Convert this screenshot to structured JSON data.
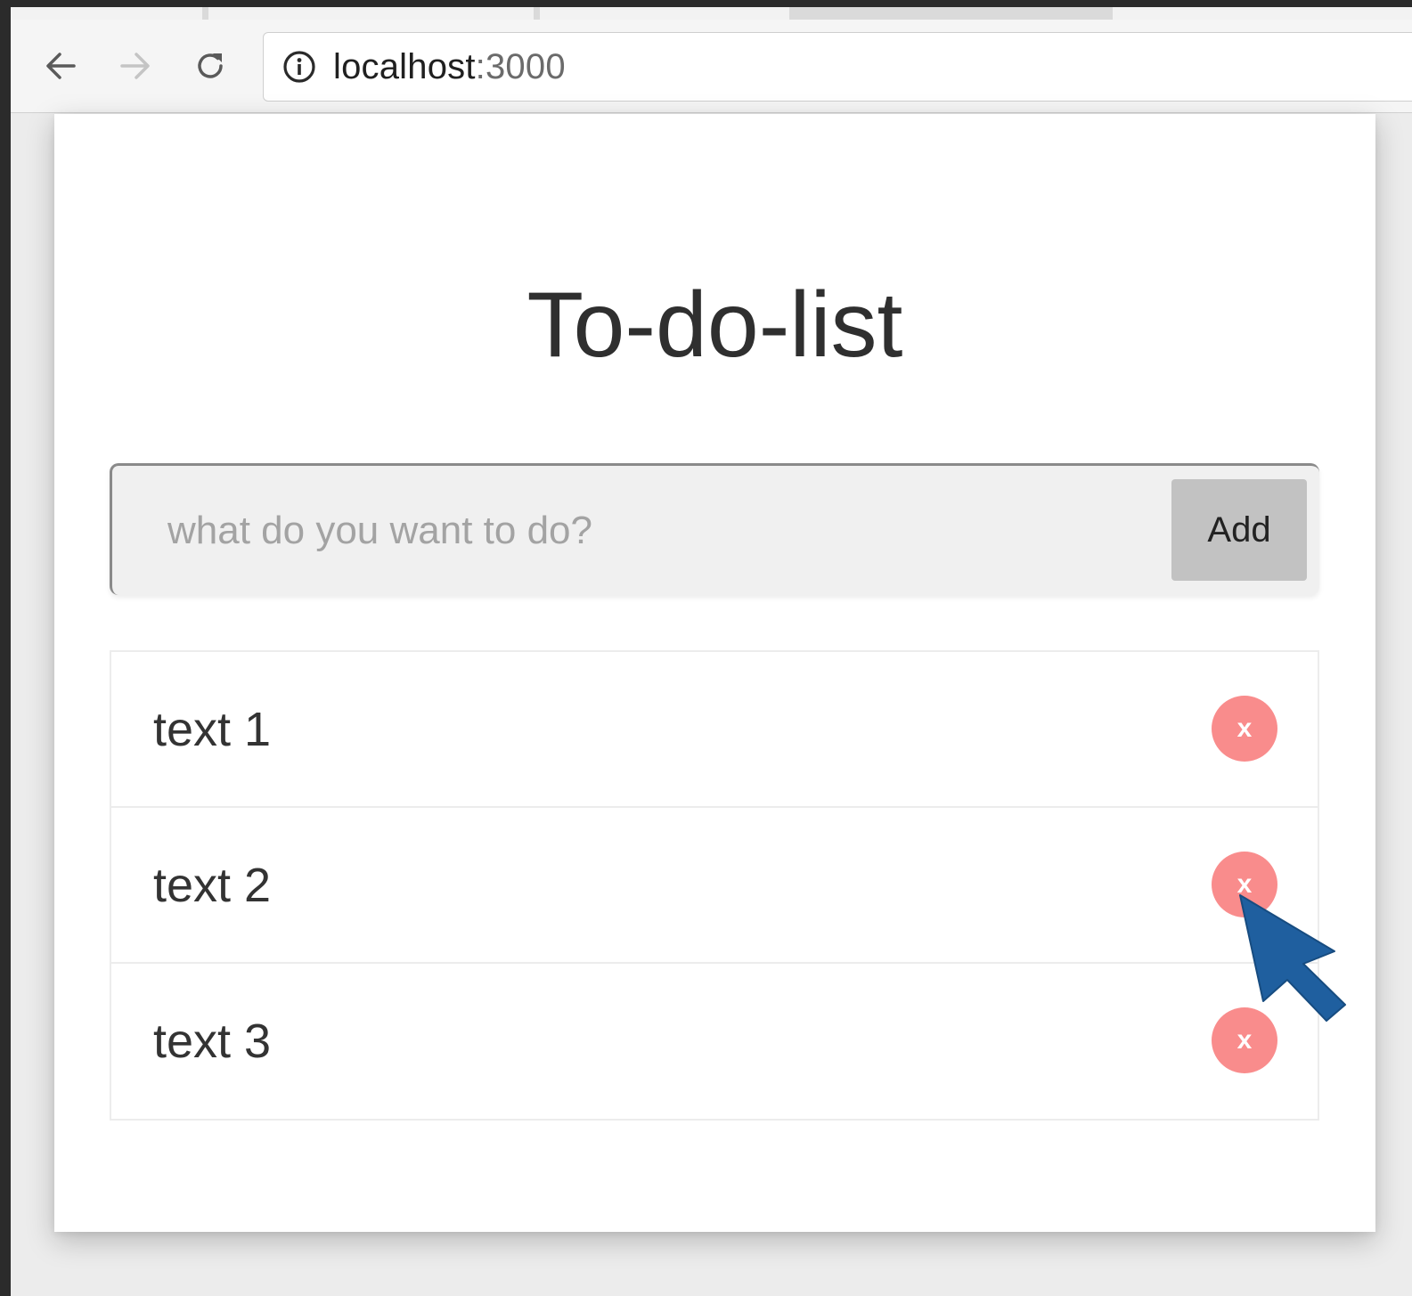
{
  "browser": {
    "url_host": "localhost",
    "url_port": ":3000"
  },
  "app": {
    "title": "To-do-list",
    "input_placeholder": "what do you want to do?",
    "input_value": "",
    "add_label": "Add",
    "delete_label": "x",
    "items": [
      {
        "text": "text 1"
      },
      {
        "text": "text 2"
      },
      {
        "text": "text 3"
      }
    ]
  },
  "colors": {
    "delete_button": "#f98c8c",
    "add_button": "#c2c2c2",
    "cursor": "#1f5f9f"
  },
  "icons": {
    "back": "arrow-left-icon",
    "forward": "arrow-right-icon",
    "reload": "reload-icon",
    "info": "info-circle-icon",
    "pointer": "mouse-pointer-icon"
  }
}
